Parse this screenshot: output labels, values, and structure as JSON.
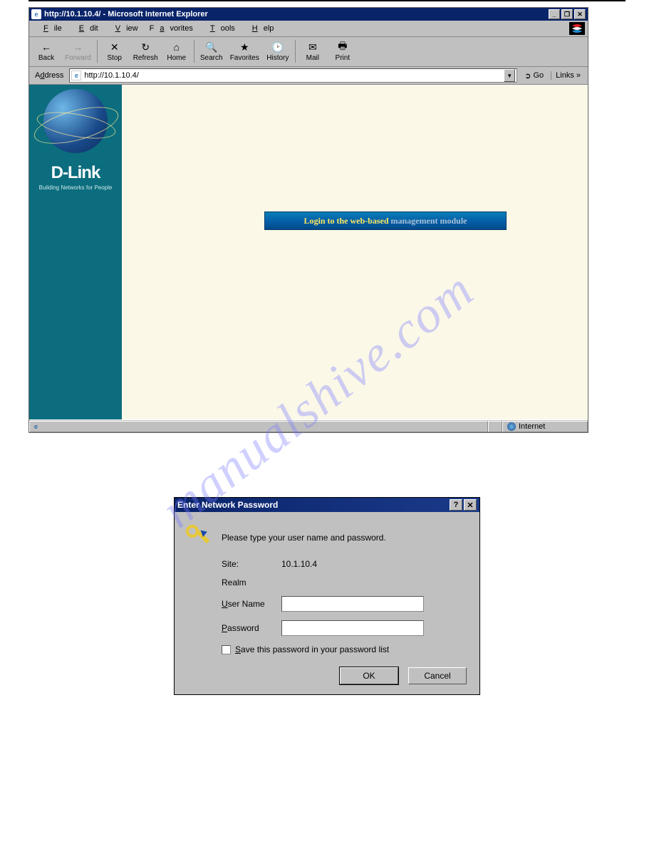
{
  "browser": {
    "window_title": "http://10.1.10.4/ - Microsoft Internet Explorer",
    "menubar": [
      "File",
      "Edit",
      "View",
      "Favorites",
      "Tools",
      "Help"
    ],
    "toolbar": [
      {
        "name": "back",
        "label": "Back",
        "icon": "←"
      },
      {
        "name": "forward",
        "label": "Forward",
        "icon": "→",
        "disabled": true
      },
      {
        "name": "stop",
        "label": "Stop",
        "icon": "✕"
      },
      {
        "name": "refresh",
        "label": "Refresh",
        "icon": "↻"
      },
      {
        "name": "home",
        "label": "Home",
        "icon": "⌂"
      },
      {
        "name": "search",
        "label": "Search",
        "icon": "🔍"
      },
      {
        "name": "favorites",
        "label": "Favorites",
        "icon": "★"
      },
      {
        "name": "history",
        "label": "History",
        "icon": "🕑"
      },
      {
        "name": "mail",
        "label": "Mail",
        "icon": "✉"
      },
      {
        "name": "print",
        "label": "Print",
        "icon": "🖶"
      }
    ],
    "address_label": "Address",
    "address_value": "http://10.1.10.4/",
    "go_label": "Go",
    "links_label": "Links »",
    "statusbar_zone": "Internet"
  },
  "sidebar": {
    "brand": "D-Link",
    "tagline": "Building Networks for People"
  },
  "login_banner": {
    "text_yellow": "Login to the web-based ",
    "text_gray": "management module"
  },
  "dialog": {
    "title": "Enter Network Password",
    "prompt": "Please type your user name and password.",
    "site_label": "Site:",
    "site_value": "10.1.10.4",
    "realm_label": "Realm",
    "username_label": "User Name",
    "username_value": "",
    "password_label": "Password",
    "password_value": "",
    "save_label": "Save this password in your password list",
    "save_checked": false,
    "ok_label": "OK",
    "cancel_label": "Cancel"
  },
  "watermark": "manualshive.com"
}
